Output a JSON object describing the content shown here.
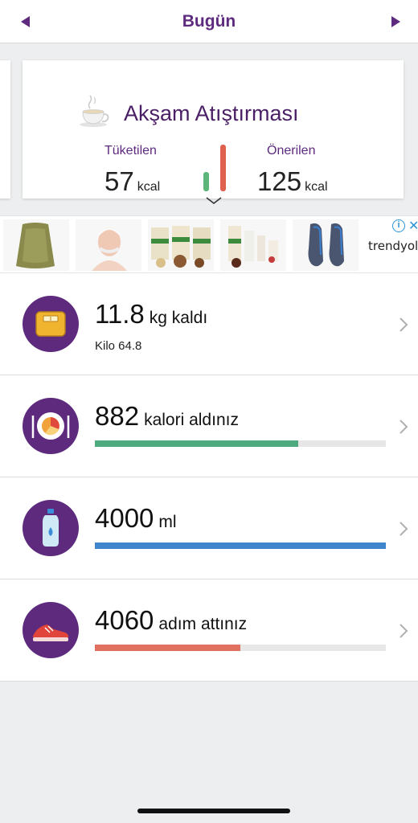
{
  "header": {
    "title": "Bugün"
  },
  "meal": {
    "title": "Akşam Atıştırması",
    "consumed_label": "Tüketilen",
    "consumed_value": "57",
    "consumed_unit": "kcal",
    "recommended_label": "Önerilen",
    "recommended_value": "125",
    "recommended_unit": "kcal",
    "colors": {
      "consumed": "#5cb57a",
      "recommended": "#e06050"
    }
  },
  "ad": {
    "brand": "trendyol",
    "info_icon": "info-icon",
    "close_icon": "close-icon"
  },
  "summary": {
    "weight": {
      "value": "11.8",
      "suffix": "kg kaldı",
      "detail": "Kilo 64.8",
      "icon": "scale-icon"
    },
    "calories": {
      "value": "882",
      "suffix": "kalori aldınız",
      "progress": 0.7,
      "color": "#4daa7e",
      "icon": "plate-icon"
    },
    "water": {
      "value": "4000",
      "suffix": "ml",
      "progress": 1.0,
      "color": "#3f86cc",
      "icon": "water-bottle-icon"
    },
    "steps": {
      "value": "4060",
      "suffix": "adım attınız",
      "progress": 0.5,
      "color": "#e07060",
      "icon": "sneaker-icon"
    }
  },
  "colors": {
    "brand": "#5d2a7e"
  }
}
